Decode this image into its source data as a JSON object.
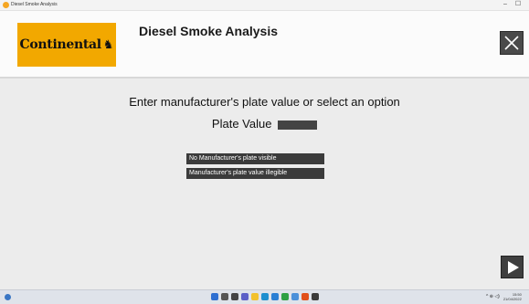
{
  "window": {
    "title": "Diesel Smoke Analysis",
    "minimize_label": "–",
    "maximize_label": "☐"
  },
  "header": {
    "logo_text": "Continental",
    "logo_mark": "♞",
    "title": "Diesel Smoke Analysis",
    "close_icon": "close-icon"
  },
  "main": {
    "prompt": "Enter manufacturer's plate value or select an option",
    "plate_label": "Plate Value",
    "plate_value": "",
    "options": [
      "No Manufacturer's plate visible",
      "Manufacturer's plate value illegible"
    ],
    "next_icon": "play-icon"
  },
  "taskbar": {
    "tray_icons": "^ ⊕ ◁)",
    "time": "15:50",
    "date": "21/04/2022",
    "apps": [
      {
        "name": "start-icon",
        "color": "#2f6fd1"
      },
      {
        "name": "search-icon",
        "color": "#555555"
      },
      {
        "name": "task-view-icon",
        "color": "#444444"
      },
      {
        "name": "chat-icon",
        "color": "#5b5fc7"
      },
      {
        "name": "explorer-icon",
        "color": "#f2c12e"
      },
      {
        "name": "edge-icon",
        "color": "#1e8fcf"
      },
      {
        "name": "store-icon",
        "color": "#2a7fd4"
      },
      {
        "name": "chrome-icon",
        "color": "#2ea043"
      },
      {
        "name": "settings-icon",
        "color": "#4a90d9"
      },
      {
        "name": "app-icon",
        "color": "#e1501a"
      },
      {
        "name": "terminal-icon",
        "color": "#3a3a3a"
      }
    ]
  },
  "colors": {
    "brand": "#f2a800",
    "button": "#3b3b3b"
  }
}
